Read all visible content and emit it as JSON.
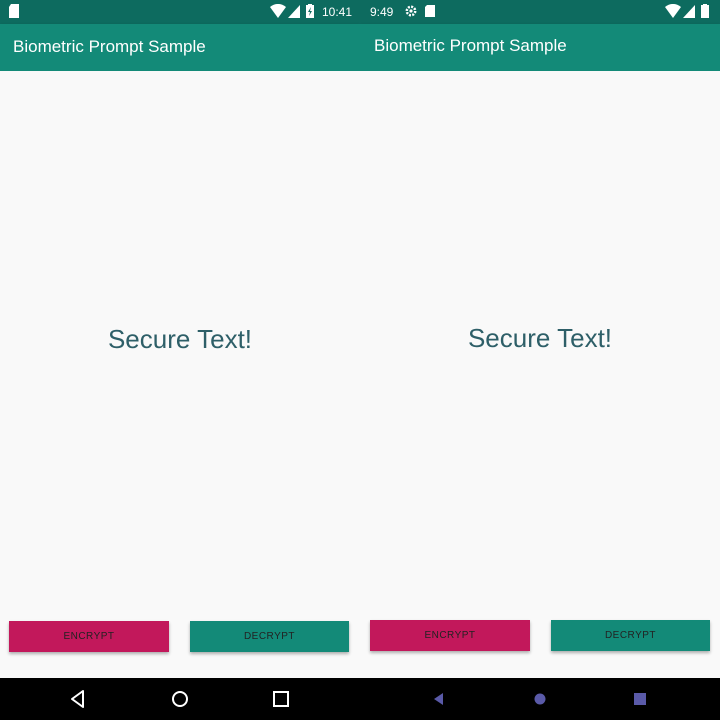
{
  "left": {
    "status": {
      "time": "10:41"
    },
    "app_title": "Biometric Prompt Sample",
    "secure_text": "Secure Text!",
    "buttons": {
      "encrypt": "ENCRYPT",
      "decrypt": "DECRYPT"
    },
    "nav": [
      "back-icon",
      "home-icon",
      "recents-icon"
    ]
  },
  "right": {
    "status": {
      "time": "9:49"
    },
    "app_title": "Biometric Prompt Sample",
    "secure_text": "Secure Text!",
    "buttons": {
      "encrypt": "ENCRYPT",
      "decrypt": "DECRYPT"
    },
    "nav": [
      "back-icon",
      "home-icon",
      "recents-icon"
    ]
  },
  "colors": {
    "status_bar": "#0d6b5f",
    "app_bar": "#138a78",
    "encrypt_button": "#c2185b",
    "decrypt_button": "#138a78",
    "secure_text": "#2e5f68",
    "nav_bar": "#000000",
    "nav_icons_right": "#5a5aa8"
  }
}
